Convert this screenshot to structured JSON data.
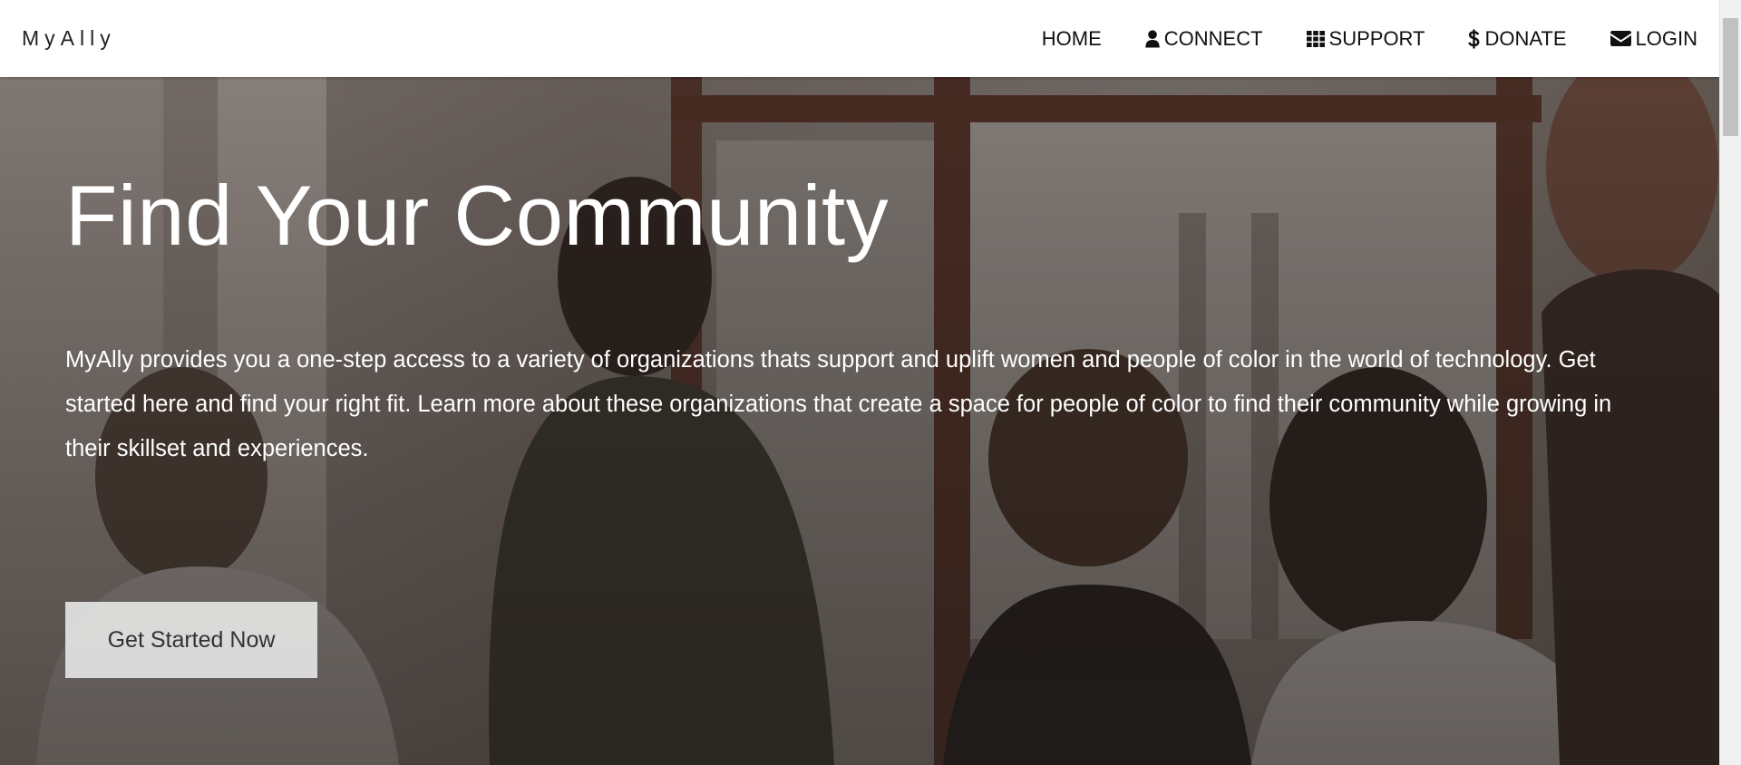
{
  "brand": {
    "name": "MyAlly"
  },
  "nav": {
    "items": [
      {
        "label": "HOME",
        "icon": ""
      },
      {
        "label": "CONNECT",
        "icon": "user-icon"
      },
      {
        "label": "SUPPORT",
        "icon": "grid-icon"
      },
      {
        "label": "DONATE",
        "icon": "dollar-icon"
      },
      {
        "label": "LOGIN",
        "icon": "envelope-icon"
      }
    ]
  },
  "hero": {
    "title": "Find Your Community",
    "description": "MyAlly provides you a one-step access to a variety of organizations thats support and uplift women and people of color in the world of technology. Get started here and find your right fit. Learn more about these organizations that create a space for people of color to find their community while growing in their skillset and experiences.",
    "cta_label": "Get Started Now"
  },
  "colors": {
    "nav_background": "#ffffff",
    "nav_text": "#111111",
    "hero_text": "#ffffff",
    "cta_background": "#ebebeb",
    "cta_text": "#333333"
  }
}
